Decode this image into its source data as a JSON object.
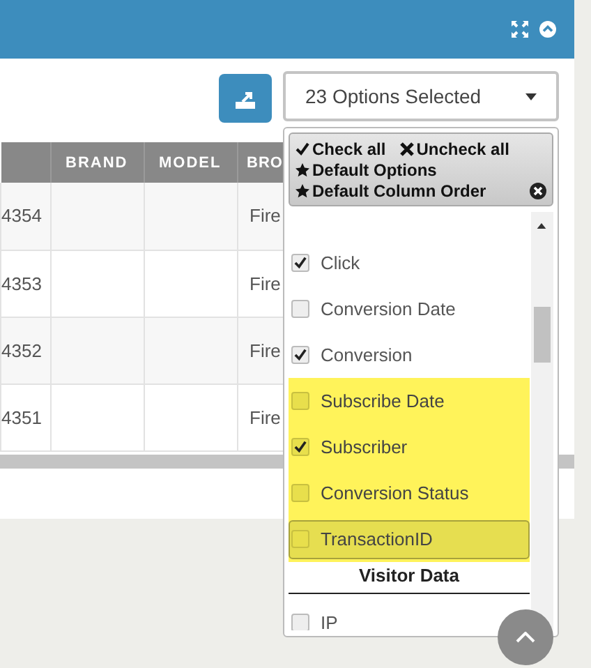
{
  "toolbar": {
    "dropdown": {
      "label": "23 Options Selected",
      "expanded": true
    }
  },
  "table": {
    "columns": [
      "",
      "BRAND",
      "MODEL",
      "BRO"
    ],
    "rows": [
      [
        "4354",
        "",
        "",
        "Fire"
      ],
      [
        "4353",
        "",
        "",
        "Fire"
      ],
      [
        "4352",
        "",
        "",
        "Fire"
      ],
      [
        "4351",
        "",
        "",
        "Fire"
      ]
    ]
  },
  "dropdown_menu": {
    "actions": [
      {
        "label": "Check all"
      },
      {
        "label": "Uncheck all"
      },
      {
        "label": "Default Options"
      },
      {
        "label": "Default Column Order"
      }
    ],
    "items": [
      {
        "kind": "option",
        "label": "Click",
        "checked": true,
        "highlighted": false,
        "focused": false
      },
      {
        "kind": "option",
        "label": "Conversion Date",
        "checked": false,
        "highlighted": false,
        "focused": false
      },
      {
        "kind": "option",
        "label": "Conversion",
        "checked": true,
        "highlighted": false,
        "focused": false
      },
      {
        "kind": "option",
        "label": "Subscribe Date",
        "checked": false,
        "highlighted": true,
        "focused": false
      },
      {
        "kind": "option",
        "label": "Subscriber",
        "checked": true,
        "highlighted": true,
        "focused": false
      },
      {
        "kind": "option",
        "label": "Conversion Status",
        "checked": false,
        "highlighted": true,
        "focused": false
      },
      {
        "kind": "option",
        "label": "TransactionID",
        "checked": false,
        "highlighted": true,
        "focused": true
      },
      {
        "kind": "header",
        "label": "Visitor Data"
      },
      {
        "kind": "option",
        "label": "IP",
        "checked": false,
        "highlighted": false,
        "focused": false
      }
    ]
  }
}
